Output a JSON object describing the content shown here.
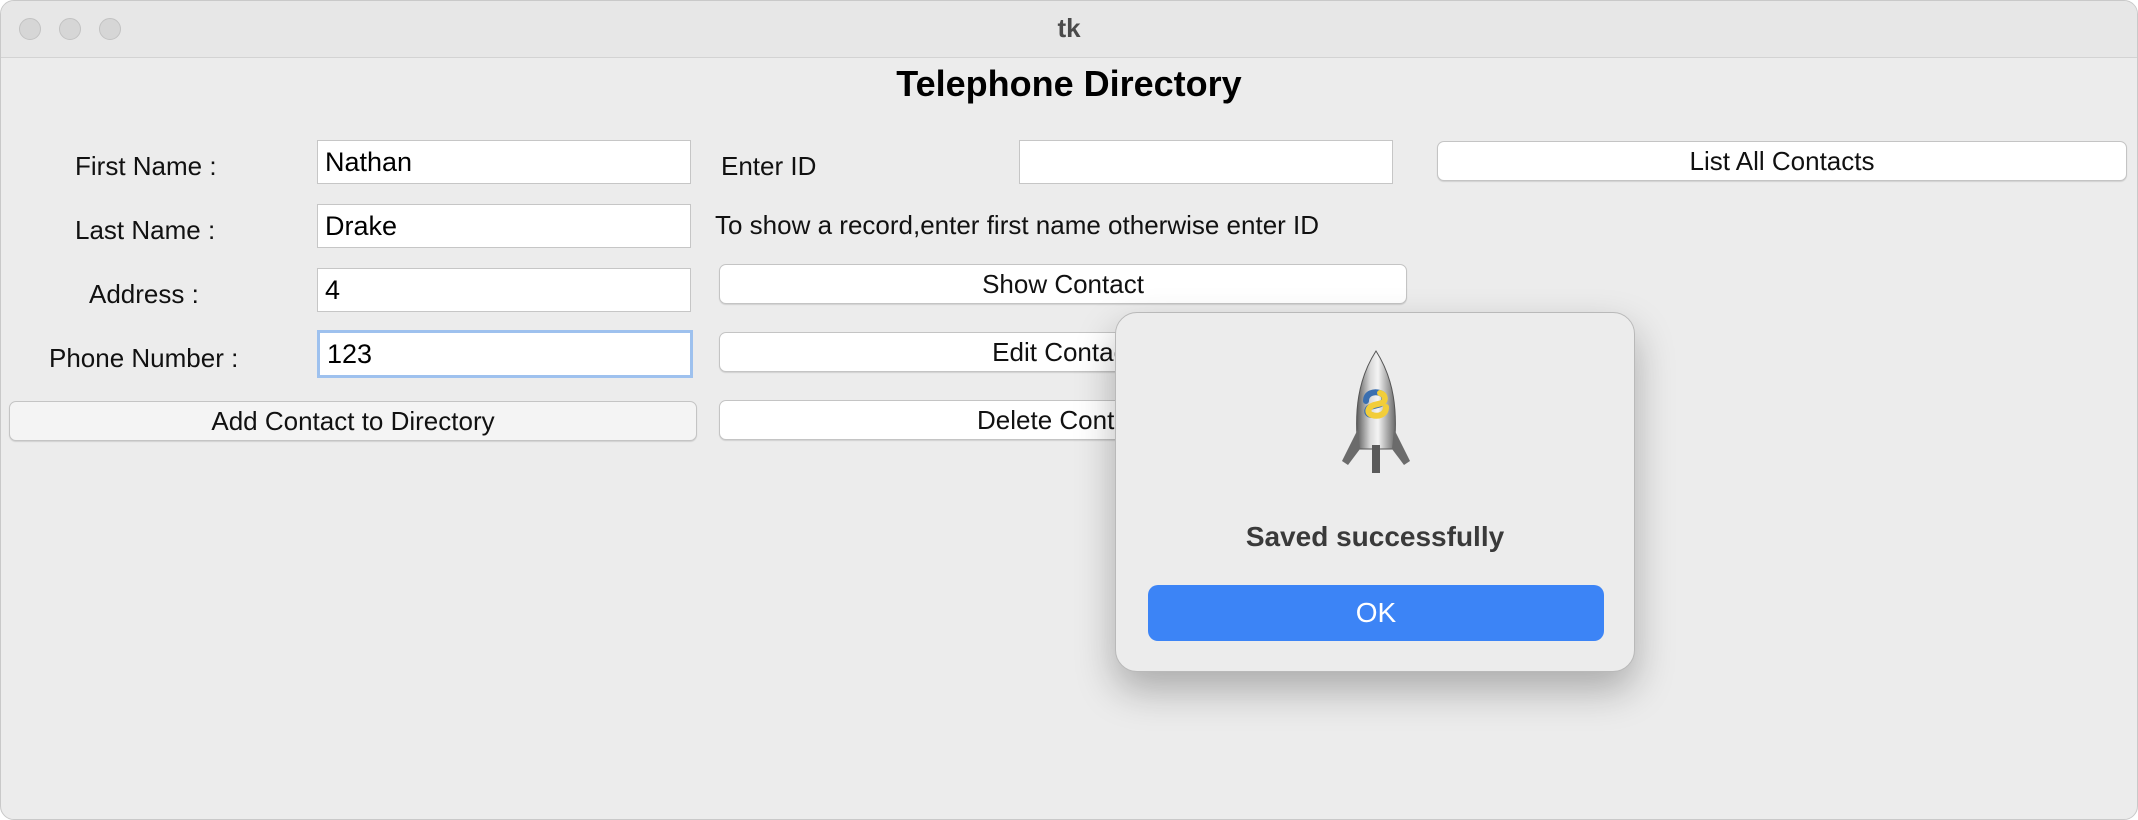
{
  "window": {
    "title": "tk"
  },
  "app": {
    "heading": "Telephone Directory"
  },
  "form": {
    "first_name_label": "First Name :",
    "first_name_value": "Nathan",
    "last_name_label": "Last Name :",
    "last_name_value": "Drake",
    "address_label": "Address :",
    "address_value": "4",
    "phone_label": "Phone Number :",
    "phone_value": "123",
    "add_button": "Add Contact to Directory"
  },
  "lookup": {
    "id_label": "Enter ID",
    "id_value": "",
    "hint": "To show a record,enter first name otherwise enter ID",
    "show_button": "Show Contact",
    "edit_button": "Edit Contact",
    "delete_button": "Delete Contact",
    "list_all_button": "List All Contacts"
  },
  "dialog": {
    "message": "Saved successfully",
    "ok_label": "OK",
    "icon": "python-rocket-icon"
  }
}
